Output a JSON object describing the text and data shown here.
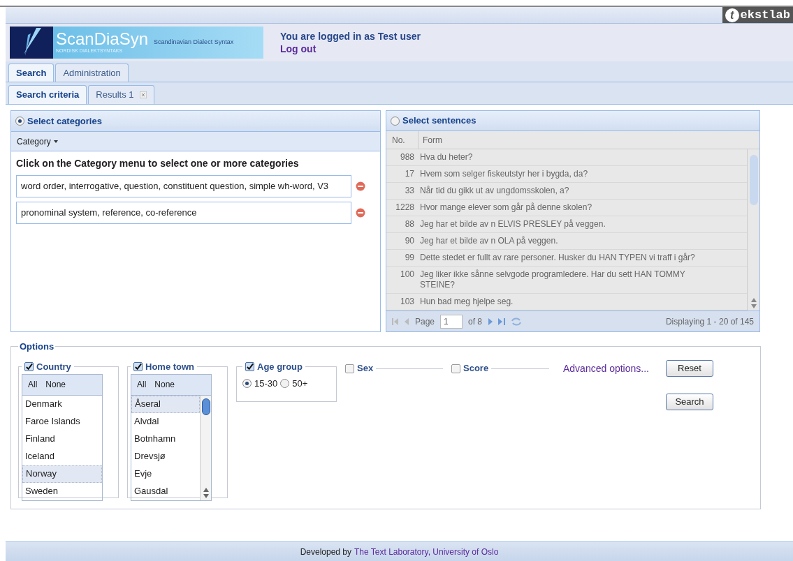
{
  "brand": {
    "logo_letter": "t",
    "logo_rest": "ekstlab",
    "title": "ScanDiaSyn",
    "subtitle": "Scandinavian Dialect Syntax",
    "tagline": "NORDISK DIALEKTSYNTAKS"
  },
  "user": {
    "status": "You are logged in as Test user",
    "logout": "Log out"
  },
  "tabs": [
    {
      "label": "Search",
      "selected": true
    },
    {
      "label": "Administration",
      "selected": false
    }
  ],
  "subtabs": [
    {
      "label": "Search criteria",
      "selected": true,
      "closable": false
    },
    {
      "label": "Results 1",
      "selected": false,
      "closable": true
    }
  ],
  "categories_panel": {
    "title": "Select categories",
    "selected": true,
    "menu": "Category",
    "instruction": "Click on the Category menu to select one or more categories",
    "items": [
      "word order, interrogative, question, constituent question, simple wh-word, V3",
      "pronominal system, reference, co-reference"
    ]
  },
  "sentences_panel": {
    "title": "Select sentences",
    "selected": false,
    "columns": [
      "No.",
      "Form"
    ],
    "rows": [
      {
        "no": "988",
        "form": "Hva du heter?"
      },
      {
        "no": "17",
        "form": "Hvem som selger fiskeutstyr her i bygda, da?"
      },
      {
        "no": "33",
        "form": "Når tid du gikk ut av ungdomsskolen, a?"
      },
      {
        "no": "1228",
        "form": "Hvor mange elever som går på denne skolen?"
      },
      {
        "no": "88",
        "form": "Jeg har et bilde av n ELVIS PRESLEY på veggen."
      },
      {
        "no": "90",
        "form": "Jeg har et bilde av n OLA på veggen."
      },
      {
        "no": "99",
        "form": "Dette stedet er fullt av rare personer. Husker du HAN TYPEN vi traff i går?"
      },
      {
        "no": "100",
        "form": "Jeg liker ikke sånne selvgode programledere. Har du sett HAN TOMMY STEINE?"
      },
      {
        "no": "103",
        "form": "Hun bad meg hjelpe seg."
      }
    ],
    "pager": {
      "page_label": "Page",
      "page": "1",
      "of": "of 8",
      "display": "Displaying 1 - 20 of 145"
    }
  },
  "options": {
    "title": "Options",
    "groups": [
      {
        "kind": "list",
        "label": "Country",
        "checked": true,
        "all": "All",
        "none": "None",
        "scrollbar": false,
        "items": [
          {
            "label": "Denmark",
            "selected": false
          },
          {
            "label": "Faroe Islands",
            "selected": false
          },
          {
            "label": "Finland",
            "selected": false
          },
          {
            "label": "Iceland",
            "selected": false
          },
          {
            "label": "Norway",
            "selected": true
          },
          {
            "label": "Sweden",
            "selected": false
          }
        ]
      },
      {
        "kind": "list",
        "label": "Home town",
        "checked": true,
        "all": "All",
        "none": "None",
        "scrollbar": true,
        "items": [
          {
            "label": "Åseral",
            "selected": true
          },
          {
            "label": "Alvdal",
            "selected": false
          },
          {
            "label": "Botnhamn",
            "selected": false
          },
          {
            "label": "Drevsjø",
            "selected": false
          },
          {
            "label": "Evje",
            "selected": false
          },
          {
            "label": "Gausdal",
            "selected": false
          }
        ]
      },
      {
        "kind": "radio",
        "label": "Age group",
        "checked": true,
        "choices": [
          {
            "label": "15-30",
            "selected": true
          },
          {
            "label": "50+",
            "selected": false
          }
        ]
      },
      {
        "kind": "collapsed",
        "label": "Sex",
        "checked": false
      },
      {
        "kind": "collapsed",
        "label": "Score",
        "checked": false
      }
    ],
    "advanced": "Advanced options...",
    "buttons": [
      "Reset",
      "Search"
    ]
  },
  "footer": {
    "prefix": "Developed by",
    "link": "The Text Laboratory, University of Oslo"
  }
}
